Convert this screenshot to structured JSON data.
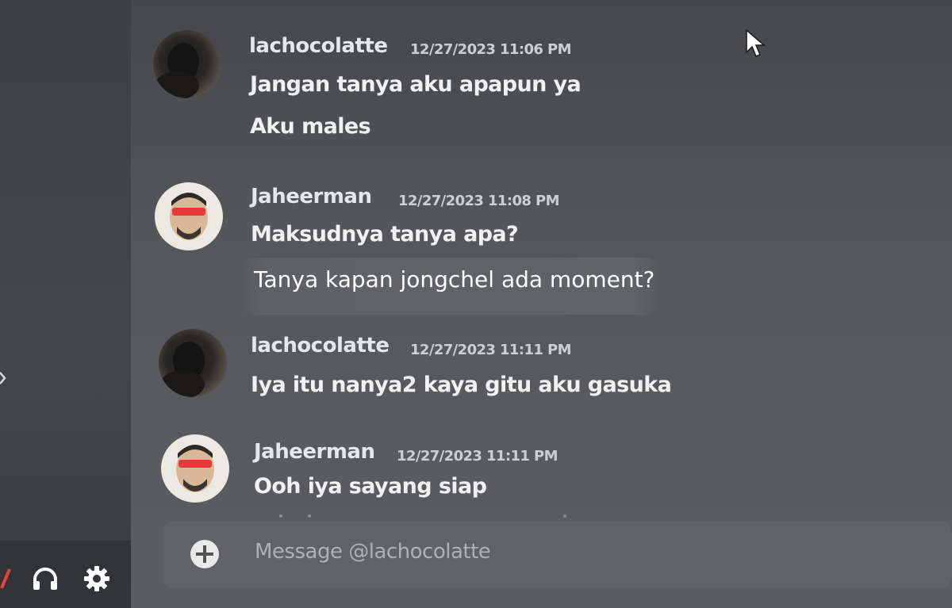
{
  "conversation": {
    "groups": [
      {
        "username": "lachocolatte",
        "timestamp": "12/27/2023 11:06 PM",
        "messages": [
          "Jangan tanya aku apapun ya",
          "Aku males"
        ]
      },
      {
        "username": "Jaheerman",
        "timestamp": "12/27/2023 11:08 PM",
        "messages": [
          "Maksudnya tanya apa?"
        ]
      },
      {
        "username": "lachocolatte",
        "timestamp": "12/27/2023 11:11 PM",
        "messages": [
          "Iya itu nanya2 kaya gitu aku gasuka"
        ]
      },
      {
        "username": "Jaheerman",
        "timestamp": "12/27/2023 11:11 PM",
        "messages": [
          "Ooh iya sayang siap"
        ]
      }
    ],
    "overlay_text": "Tanya kapan jongchel ada moment?"
  },
  "composer": {
    "placeholder": "Message @lachocolatte"
  },
  "icons": {
    "plus": "add-circle-icon",
    "headset": "headset-icon",
    "settings": "gear-icon",
    "mute": "mic-muted-icon",
    "cursor": "mouse-pointer-icon"
  }
}
